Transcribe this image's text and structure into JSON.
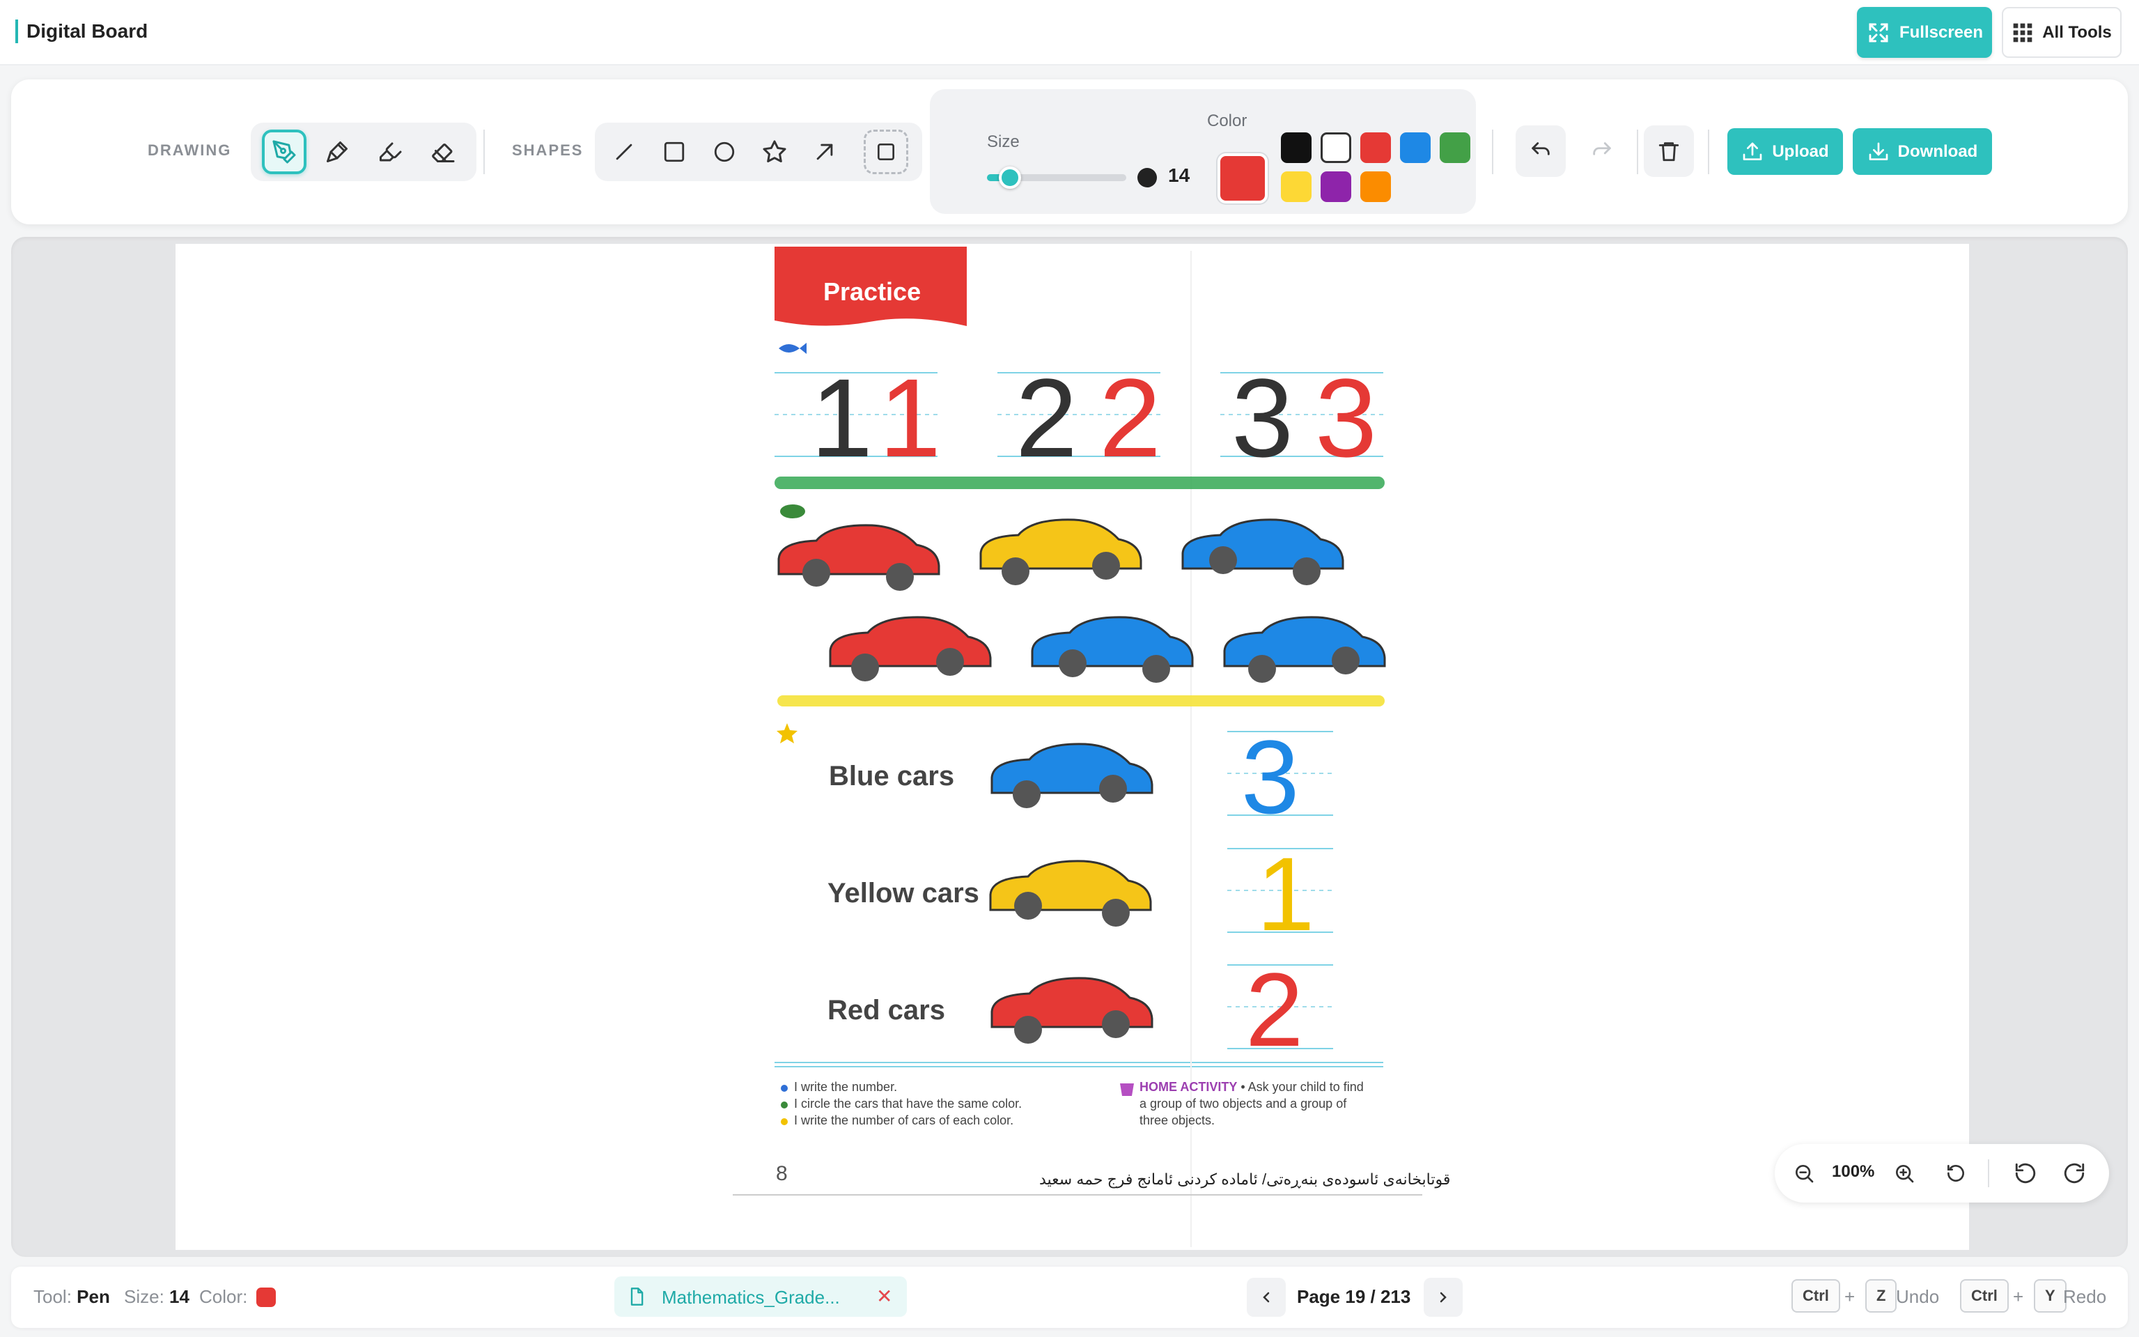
{
  "app": {
    "title": "Digital Board"
  },
  "header": {
    "fullscreen_label": "Fullscreen",
    "all_tools_label": "All Tools"
  },
  "toolbar": {
    "drawing_label": "DRAWING",
    "drawing_tools": [
      "pen-icon",
      "marker-icon",
      "highlighter-icon",
      "eraser-icon"
    ],
    "shapes_label": "SHAPES",
    "shape_tools": [
      "line-icon",
      "rectangle-icon",
      "circle-icon",
      "star-icon",
      "arrow-icon",
      "select-icon"
    ],
    "size_label": "Size",
    "size_value": "14",
    "size_fraction": 0.1,
    "color_label": "Color",
    "current_color": "#e53935",
    "palette": [
      "#111111",
      "#ffffff",
      "#e53935",
      "#1e88e5",
      "#43a047",
      "#fdd835",
      "#8e24aa",
      "#fb8c00"
    ],
    "upload_label": "Upload",
    "download_label": "Download"
  },
  "accent_color": "#2ec1be",
  "document": {
    "banner": "Practice",
    "digits": [
      "1",
      "1",
      "2",
      "2",
      "3",
      "3"
    ],
    "rows": [
      {
        "label": "Blue cars",
        "answer": "3",
        "color": "#1e88e5"
      },
      {
        "label": "Yellow cars",
        "answer": "1",
        "color": "#fdd835"
      },
      {
        "label": "Red cars",
        "answer": "2",
        "color": "#e53935"
      }
    ],
    "notes": [
      "I write the number.",
      "I circle the cars that have the same color.",
      "I write the number of cars of each color."
    ],
    "home_activity_title": "HOME ACTIVITY",
    "home_activity_text_1": "• Ask your child to find",
    "home_activity_text_2": "a group of two objects and a group of",
    "home_activity_text_3": "three objects.",
    "page_number": "8",
    "footer_text": "قوتابخانەی ئاسودەی بنەڕەتی/ ئامادە کردنی ئامانج فرج حمە سعید"
  },
  "zoom": {
    "value": "100%"
  },
  "status": {
    "tool_label": "Tool:",
    "tool_value": "Pen",
    "size_label": "Size:",
    "size_value": "14",
    "color_label": "Color:",
    "file_name": "Mathematics_Grade...",
    "page_indicator": "Page 19 / 213",
    "undo_key1": "Ctrl",
    "undo_key2": "Z",
    "undo_label": "Undo",
    "redo_key1": "Ctrl",
    "redo_key2": "Y",
    "redo_label": "Redo",
    "plus": "+"
  }
}
